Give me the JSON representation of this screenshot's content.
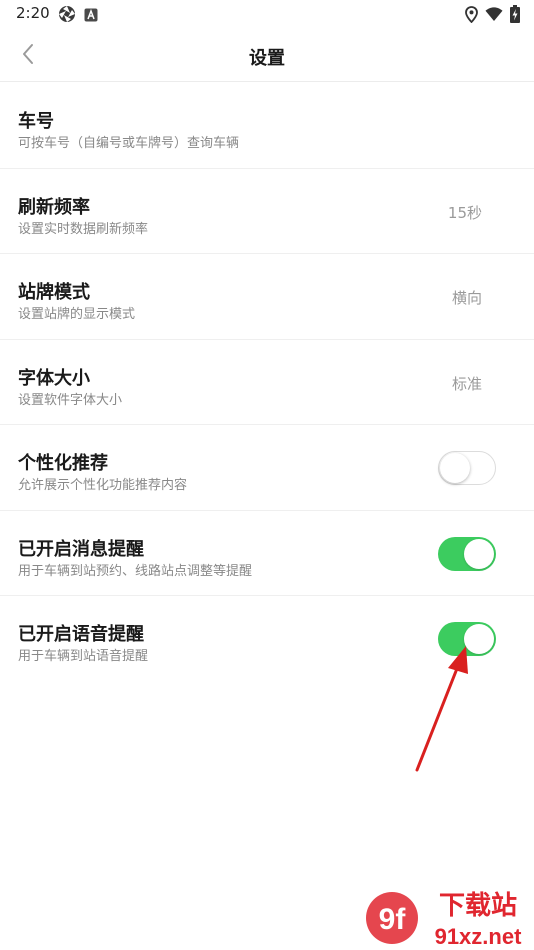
{
  "status_bar": {
    "time": "2:20",
    "left_icons": [
      "aperture-icon",
      "app-a-icon"
    ],
    "right_icons": [
      "location-icon",
      "wifi-icon",
      "battery-charging-icon"
    ]
  },
  "header": {
    "title": "设置",
    "back_icon": "chevron-left-icon"
  },
  "settings": [
    {
      "title": "车号",
      "desc": "可按车号（自编号或车牌号）查询车辆"
    },
    {
      "title": "刷新频率",
      "desc": "设置实时数据刷新频率",
      "value": "15秒"
    },
    {
      "title": "站牌模式",
      "desc": "设置站牌的显示模式",
      "value": "横向"
    },
    {
      "title": "字体大小",
      "desc": "设置软件字体大小",
      "value": "标准"
    },
    {
      "title": "个性化推荐",
      "desc": "允许展示个性化功能推荐内容",
      "toggle": false
    },
    {
      "title": "已开启消息提醒",
      "desc": "用于车辆到站预约、线路站点调整等提醒",
      "toggle": true
    },
    {
      "title": "已开启语音提醒",
      "desc": "用于车辆到站语音提醒",
      "toggle": true
    }
  ],
  "watermark": {
    "text_top": "下载站",
    "text_bottom": "91xz.net"
  },
  "colors": {
    "toggle_on": "#3ccc5f",
    "annotation_arrow": "#d9201f",
    "watermark_red": "#e0262f"
  }
}
